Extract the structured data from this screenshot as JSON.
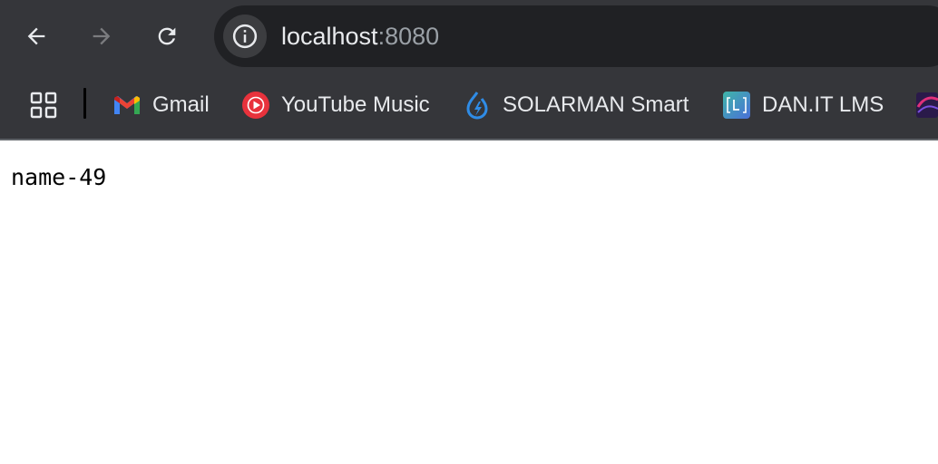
{
  "toolbar": {
    "icons": {
      "back": "arrow-left-icon",
      "forward": "arrow-right-icon",
      "reload": "reload-icon",
      "site_info": "info-icon"
    },
    "url": {
      "host": "localhost",
      "port": ":8080"
    }
  },
  "bookmarks": {
    "apps_icon": "apps-grid-icon",
    "items": [
      {
        "label": "Gmail",
        "icon": "gmail-icon"
      },
      {
        "label": "YouTube Music",
        "icon": "youtube-music-icon"
      },
      {
        "label": "SOLARMAN Smart",
        "icon": "solarman-icon"
      },
      {
        "label": "DAN.IT LMS",
        "icon": "danit-lms-icon"
      }
    ]
  },
  "page": {
    "text": "name-49"
  },
  "colors": {
    "chrome_bg": "#35363a",
    "omnibox_bg": "#202124",
    "page_bg": "#ffffff"
  }
}
